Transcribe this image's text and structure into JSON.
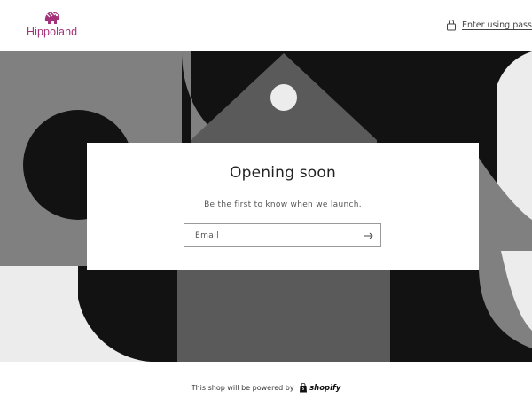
{
  "header": {
    "logo_text": "Hippoland",
    "password_link": "Enter using password"
  },
  "card": {
    "title": "Opening soon",
    "subtitle": "Be the first to know when we launch.",
    "email_placeholder": "Email",
    "submit_icon": "arrow-right-icon"
  },
  "footer": {
    "powered_text": "This shop will be powered by",
    "shopify_label": "shopify"
  },
  "colors": {
    "brand": "#a3327a",
    "banner_dark": "#121212",
    "banner_mid": "#5a5a5a",
    "banner_gray": "#808080",
    "banner_light": "#ececec"
  },
  "icons": {
    "logo": "hippo-logo-icon",
    "lock": "lock-icon",
    "shopify": "shopify-bag-icon"
  }
}
